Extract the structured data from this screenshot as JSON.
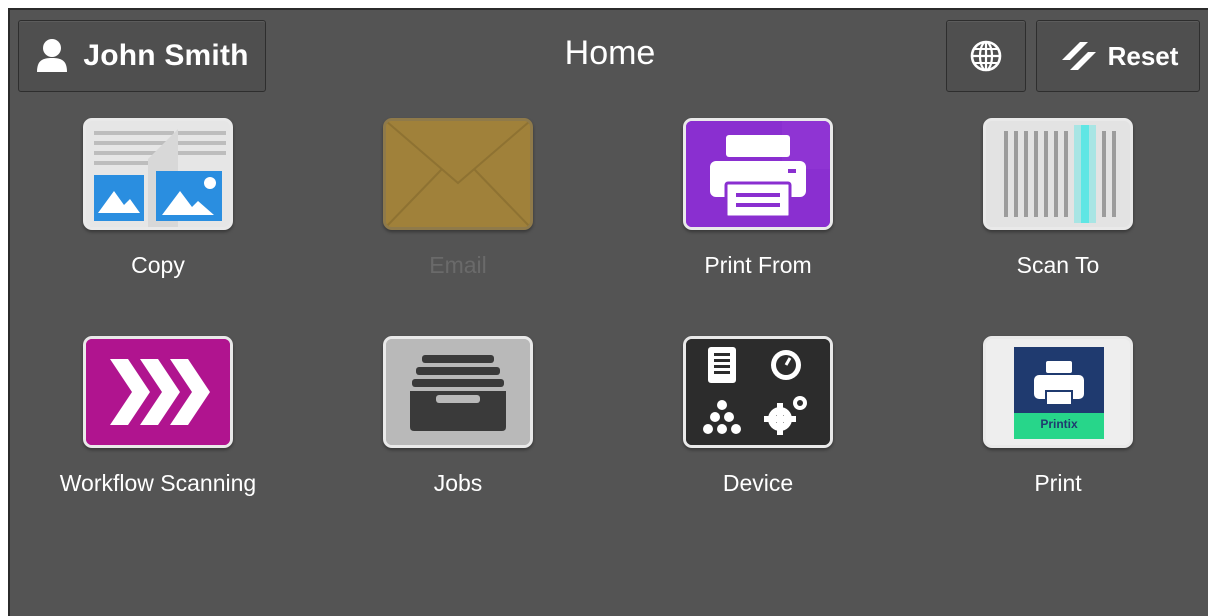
{
  "header": {
    "title": "Home",
    "user_name": "John Smith",
    "user_icon": "person-icon",
    "language_icon": "globe-icon",
    "reset_label": "Reset",
    "reset_icon": "reset-slash-icon"
  },
  "apps": [
    {
      "label": "Copy",
      "icon": "copy-icon",
      "enabled": true
    },
    {
      "label": "Email",
      "icon": "envelope-icon",
      "enabled": false
    },
    {
      "label": "Print From",
      "icon": "printer-icon",
      "enabled": true
    },
    {
      "label": "Scan To",
      "icon": "scanner-icon",
      "enabled": true
    },
    {
      "label": "Workflow Scanning",
      "icon": "chevrons-icon",
      "enabled": true
    },
    {
      "label": "Jobs",
      "icon": "job-tray-icon",
      "enabled": true
    },
    {
      "label": "Device",
      "icon": "device-status-icon",
      "enabled": true
    },
    {
      "label": "Print",
      "icon": "printix-icon",
      "enabled": true,
      "badge_text": "Printix"
    }
  ],
  "colors": {
    "background": "#545454",
    "email_tile": "#a0813a",
    "print_from_tile": "#8a2fd0",
    "workflow_tile": "#b0148f",
    "printix_navy": "#1f3a6f",
    "printix_green": "#27d68a",
    "copy_blue": "#2a8ee0",
    "scan_glow": "#5fe6e4"
  }
}
